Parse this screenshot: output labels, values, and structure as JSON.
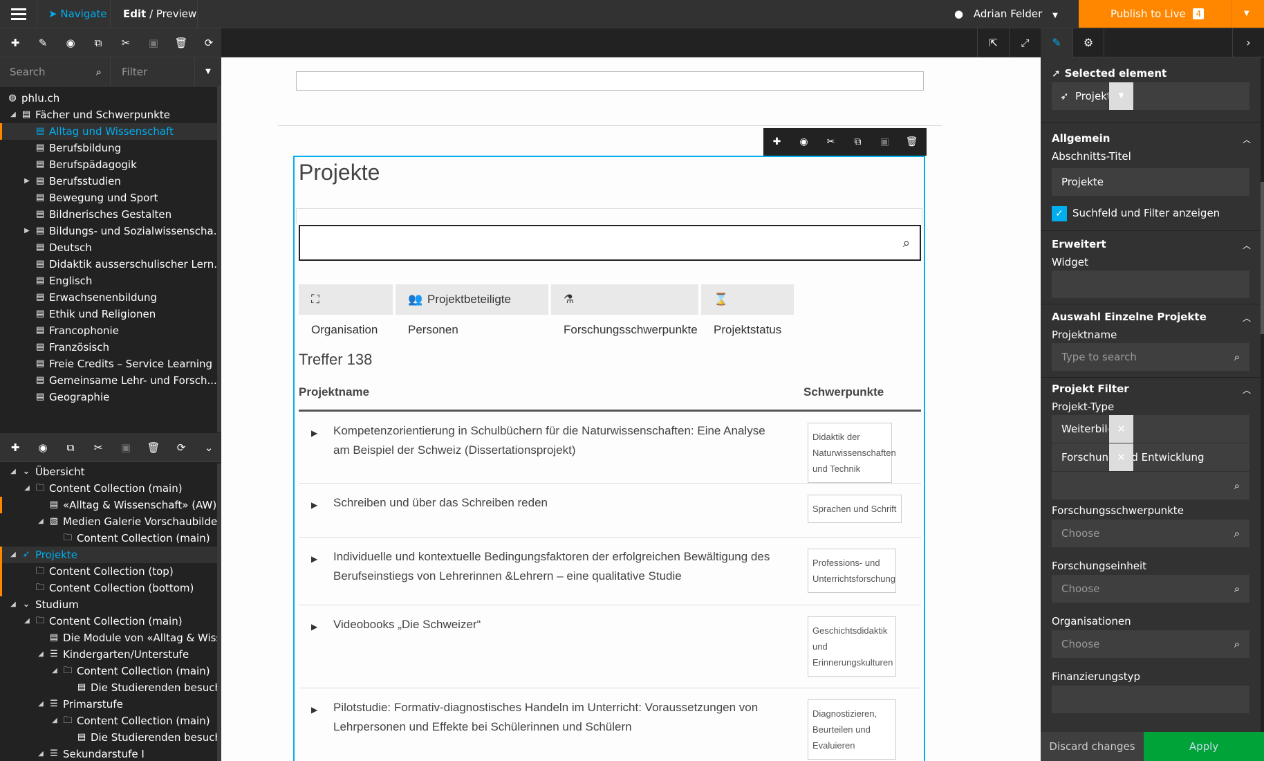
{
  "topbar": {
    "navigate_label": "Navigate",
    "edit_label": "Edit",
    "preview_label": "/ Preview",
    "user_name": "Adrian Felder",
    "publish_label": "Publish to Live",
    "publish_count": "4"
  },
  "left": {
    "search_placeholder": "Search",
    "filter_placeholder": "Filter",
    "page_tree": [
      {
        "label": "phlu.ch",
        "icon": "globe-icon",
        "level": 0
      },
      {
        "label": "Fächer und Schwerpunkte",
        "icon": "page-icon",
        "level": 1,
        "toggle": "expanded"
      },
      {
        "label": "Alltag und Wissenschaft",
        "icon": "page-icon",
        "level": 2,
        "active": true
      },
      {
        "label": "Berufsbildung",
        "icon": "page-icon",
        "level": 2
      },
      {
        "label": "Berufspädagogik",
        "icon": "page-icon",
        "level": 2
      },
      {
        "label": "Berufsstudien",
        "icon": "page-icon",
        "level": 2,
        "toggle": "collapsed"
      },
      {
        "label": "Bewegung und Sport",
        "icon": "page-icon",
        "level": 2
      },
      {
        "label": "Bildnerisches Gestalten",
        "icon": "page-icon",
        "level": 2
      },
      {
        "label": "Bildungs- und Sozialwissenscha...",
        "icon": "page-icon",
        "level": 2,
        "toggle": "collapsed"
      },
      {
        "label": "Deutsch",
        "icon": "page-icon",
        "level": 2
      },
      {
        "label": "Didaktik ausserschulischer Lern...",
        "icon": "page-icon",
        "level": 2
      },
      {
        "label": "Englisch",
        "icon": "page-icon",
        "level": 2
      },
      {
        "label": "Erwachsenenbildung",
        "icon": "page-icon",
        "level": 2
      },
      {
        "label": "Ethik und Religionen",
        "icon": "page-icon",
        "level": 2
      },
      {
        "label": "Francophonie",
        "icon": "page-icon",
        "level": 2
      },
      {
        "label": "Französisch",
        "icon": "page-icon",
        "level": 2
      },
      {
        "label": "Freie Credits – Service Learning",
        "icon": "page-icon",
        "level": 2
      },
      {
        "label": "Gemeinsame Lehr- und Forsch...",
        "icon": "page-icon",
        "level": 2
      },
      {
        "label": "Geographie",
        "icon": "page-icon",
        "level": 2
      }
    ],
    "content_tree": [
      {
        "label": "Übersicht",
        "icon": "chevron-down-icon",
        "level": 1,
        "toggle": "expanded"
      },
      {
        "label": "Content Collection (main)",
        "icon": "folder-icon",
        "level": 2,
        "toggle": "expanded"
      },
      {
        "label": "«Alltag & Wissenschaft» (AW) tr...",
        "icon": "page-icon",
        "level": 3,
        "orange": true
      },
      {
        "label": "Medien Galerie Vorschaubilder",
        "icon": "image-icon",
        "level": 3,
        "toggle": "expanded"
      },
      {
        "label": "Content Collection (main)",
        "icon": "folder-icon",
        "level": 4
      },
      {
        "label": "Projekte",
        "icon": "rocket-icon",
        "level": 1,
        "toggle": "expanded",
        "active": true
      },
      {
        "label": "Content Collection (top)",
        "icon": "folder-icon",
        "level": 2,
        "orange": true
      },
      {
        "label": "Content Collection (bottom)",
        "icon": "folder-icon",
        "level": 2,
        "orange": true
      },
      {
        "label": "Studium",
        "icon": "chevron-down-icon",
        "level": 1,
        "toggle": "expanded"
      },
      {
        "label": "Content Collection (main)",
        "icon": "folder-icon",
        "level": 2,
        "toggle": "expanded"
      },
      {
        "label": "Die Module von «Alltag & Wisse...",
        "icon": "page-icon",
        "level": 3
      },
      {
        "label": "Kindergarten/Unterstufe",
        "icon": "list-icon",
        "level": 3,
        "toggle": "expanded"
      },
      {
        "label": "Content Collection (main)",
        "icon": "folder-icon",
        "level": 4,
        "toggle": "expanded"
      },
      {
        "label": "Die Studierenden besuchen im",
        "icon": "page-icon",
        "level": 5
      },
      {
        "label": "Primarstufe",
        "icon": "list-icon",
        "level": 3,
        "toggle": "expanded"
      },
      {
        "label": "Content Collection (main)",
        "icon": "folder-icon",
        "level": 4,
        "toggle": "expanded"
      },
      {
        "label": "Die Studierenden besuchen im",
        "icon": "page-icon",
        "level": 5
      },
      {
        "label": "Sekundarstufe I",
        "icon": "list-icon",
        "level": 3,
        "toggle": "expanded"
      },
      {
        "label": "Content Collection (main)",
        "icon": "folder-icon",
        "level": 4,
        "toggle": "expanded"
      }
    ]
  },
  "page": {
    "section_title": "Projekte",
    "filters": [
      {
        "label": "Organisation",
        "icon": "sitemap-icon"
      },
      {
        "label": "Projektbeteiligte Personen",
        "icon": "users-icon"
      },
      {
        "label": "Forschungsschwerpunkte",
        "icon": "flask-icon"
      },
      {
        "label": "Projektstatus",
        "icon": "hourglass-icon"
      }
    ],
    "hits_label": "Treffer 138",
    "col_name": "Projektname",
    "col_focus": "Schwerpunkte",
    "projects": [
      {
        "title": "Kompetenzorientierung in Schulbüchern für die Naturwissenschaften: Eine Analyse am Beispiel der Schweiz (Dissertationsprojekt)",
        "focus": "Didaktik der Naturwissenschaften und Technik"
      },
      {
        "title": "Schreiben und über das Schreiben reden",
        "focus": "Sprachen und Schrift"
      },
      {
        "title": "Individuelle und kontextuelle Bedingungsfaktoren der erfolgreichen Bewältigung des Berufseinstiegs von Lehrerinnen &Lehrern – eine qualitative Studie",
        "focus": "Professions- und Unterrichtsforschung"
      },
      {
        "title": "Videobooks „Die Schweizer“",
        "focus": "Geschichtsdidaktik und Erinnerungskulturen"
      },
      {
        "title": "Pilotstudie: Formativ-diagnostisches Handeln im Unterricht: Voraussetzungen von Lehrpersonen und Effekte bei Schülerinnen und Schülern",
        "focus": "Diagnostizieren, Beurteilen und Evaluieren"
      }
    ]
  },
  "inspector": {
    "selected_heading": "Selected element",
    "selected_value": "Projekte",
    "allgemein": "Allgemein",
    "abschnitt_label": "Abschnitts-Titel",
    "abschnitt_value": "Projekte",
    "checkbox_label": "Suchfeld und Filter anzeigen",
    "erweitert": "Erweitert",
    "widget_label": "Widget",
    "auswahl": "Auswahl Einzelne Projekte",
    "projektname_label": "Projektname",
    "projektname_placeholder": "Type to search",
    "projekt_filter": "Projekt Filter",
    "projekt_type_label": "Projekt-Type",
    "type_values": [
      "Weiterbildung",
      "Forschung und Entwicklung"
    ],
    "forschung_label": "Forschungsschwerpunkte",
    "forschungseinheit_label": "Forschungseinheit",
    "organisationen_label": "Organisationen",
    "finanzierung_label": "Finanzierungstyp",
    "choose_placeholder": "Choose",
    "discard_label": "Discard changes",
    "apply_label": "Apply"
  }
}
